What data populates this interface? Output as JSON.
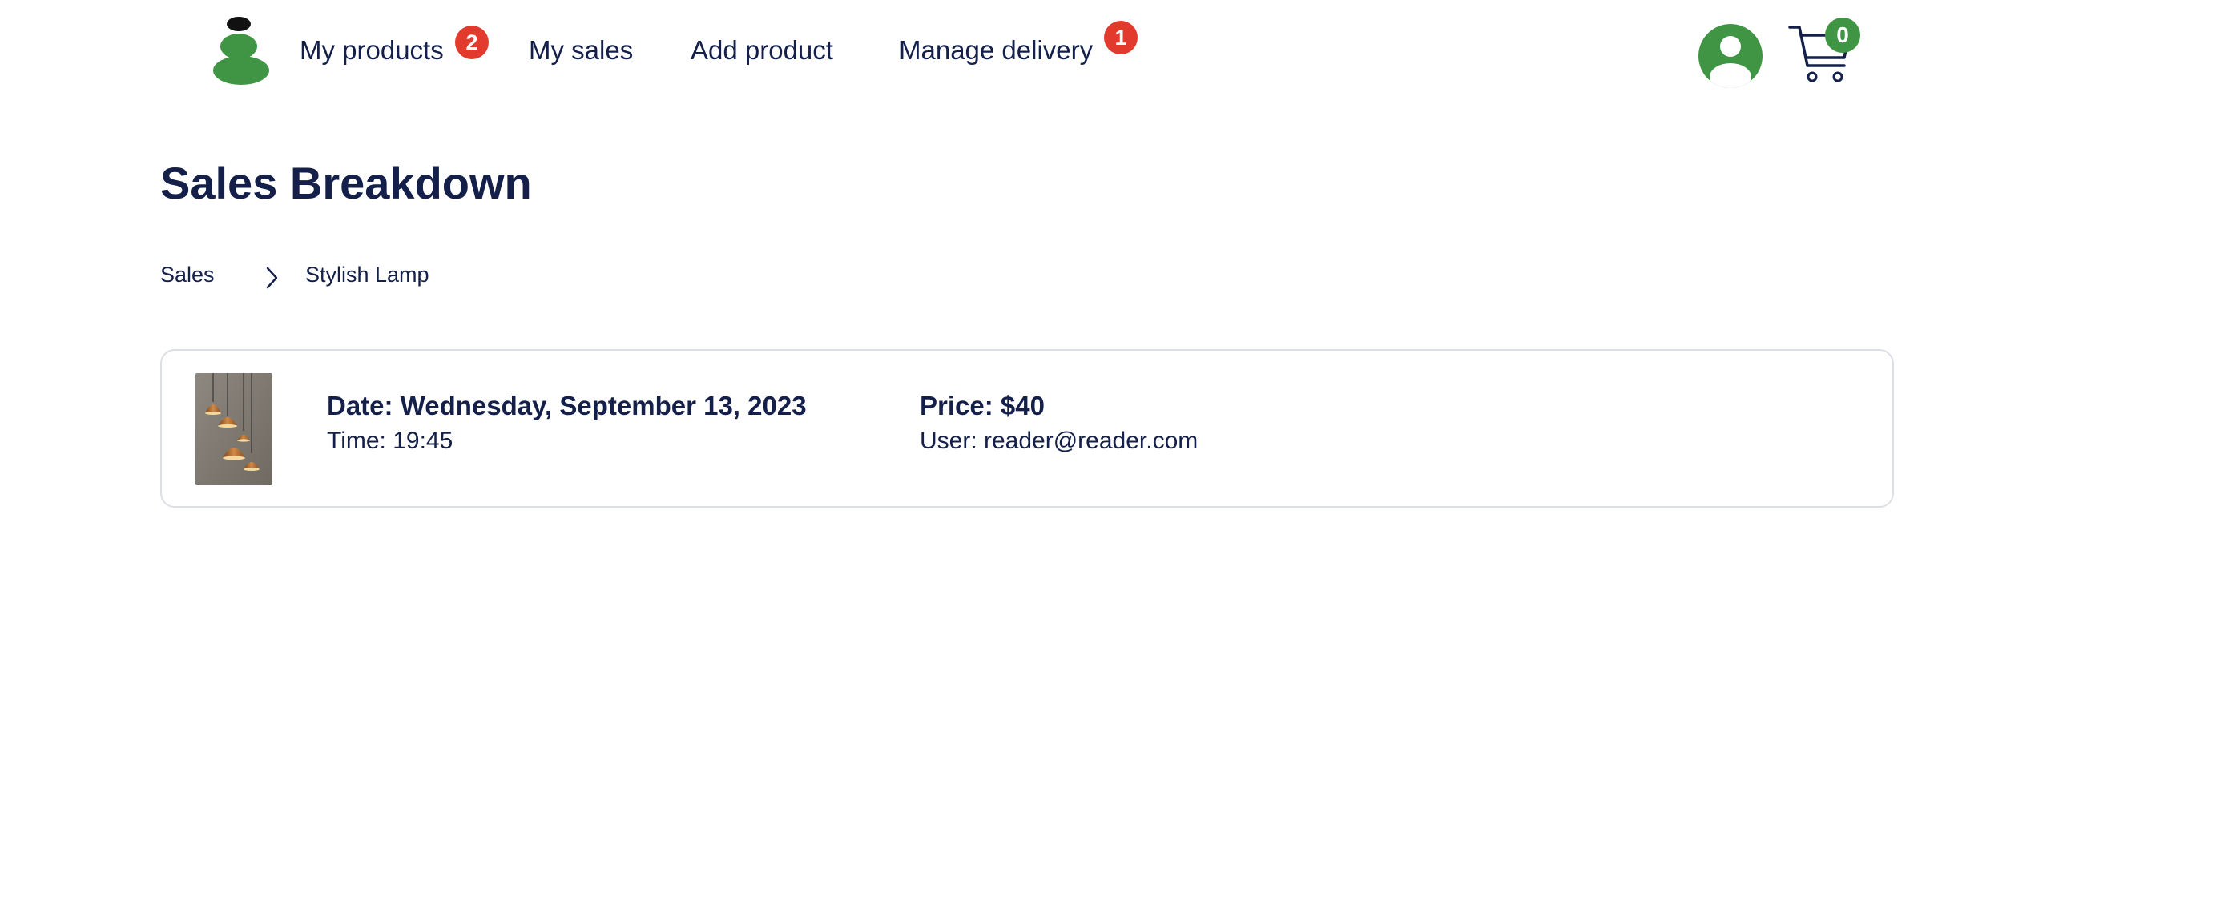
{
  "nav": {
    "logo_icon": "stacked-stones-logo-icon",
    "items": [
      {
        "label": "My products",
        "badge": "2"
      },
      {
        "label": "My sales"
      },
      {
        "label": "Add product"
      },
      {
        "label": "Manage delivery",
        "badge": "1"
      }
    ],
    "profile_icon": "user-avatar-icon",
    "cart_icon": "shopping-cart-icon",
    "cart_count": "0"
  },
  "page": {
    "title": "Sales Breakdown"
  },
  "breadcrumb": {
    "root": "Sales",
    "separator_icon": "chevron-right-icon",
    "current": "Stylish Lamp"
  },
  "sale": {
    "date": "Date: Wednesday, September 13, 2023",
    "time": "Time: 19:45",
    "price": "Price: $40",
    "user": "User: reader@reader.com",
    "image": "pendant-lamps-product-image"
  },
  "colors": {
    "brand_green": "#3f9543",
    "badge_red": "#e23b2e",
    "text_navy": "#14204a",
    "card_border": "#dcdfe6"
  }
}
